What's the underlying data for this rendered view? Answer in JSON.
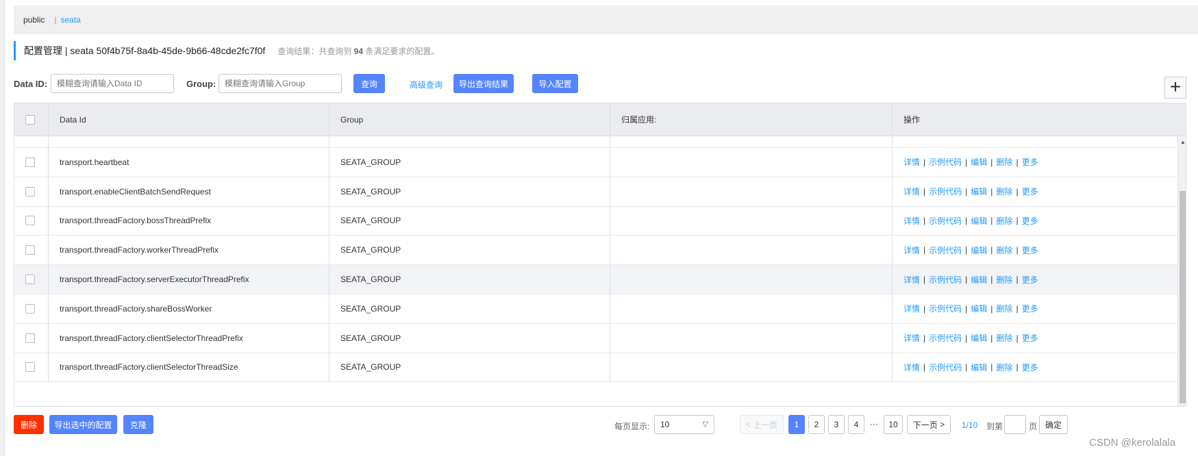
{
  "namespace": {
    "items": [
      "public",
      "seata"
    ],
    "separator": "|"
  },
  "title": {
    "main": "配置管理 | seata 50f4b75f-8a4b-45de-9b66-48cde2fc7f0f",
    "hint_prefix": "查询结果：共查询到",
    "hint_count": "94",
    "hint_suffix": "条满足要求的配置。"
  },
  "search": {
    "data_id_label": "Data ID:",
    "data_id_placeholder": "模糊查询请输入Data ID",
    "group_label": "Group:",
    "group_placeholder": "模糊查询请输入Group",
    "query_button": "查询",
    "advanced_query": "高级查询",
    "export_query": "导出查询结果",
    "import_config": "导入配置",
    "add_icon": "+"
  },
  "table": {
    "headers": [
      "Data Id",
      "Group",
      "归属应用:",
      "操作"
    ],
    "rows": [
      {
        "data_id": "transport.heartbeat",
        "group": "SEATA_GROUP",
        "app": ""
      },
      {
        "data_id": "transport.enableClientBatchSendRequest",
        "group": "SEATA_GROUP",
        "app": ""
      },
      {
        "data_id": "transport.threadFactory.bossThreadPrefix",
        "group": "SEATA_GROUP",
        "app": ""
      },
      {
        "data_id": "transport.threadFactory.workerThreadPrefix",
        "group": "SEATA_GROUP",
        "app": ""
      },
      {
        "data_id": "transport.threadFactory.serverExecutorThreadPrefix",
        "group": "SEATA_GROUP",
        "app": ""
      },
      {
        "data_id": "transport.threadFactory.shareBossWorker",
        "group": "SEATA_GROUP",
        "app": ""
      },
      {
        "data_id": "transport.threadFactory.clientSelectorThreadPrefix",
        "group": "SEATA_GROUP",
        "app": ""
      },
      {
        "data_id": "transport.threadFactory.clientSelectorThreadSize",
        "group": "SEATA_GROUP",
        "app": ""
      }
    ],
    "row_actions": [
      "详情",
      "示例代码",
      "编辑",
      "删除",
      "更多"
    ],
    "highlighted_row": 4
  },
  "footer": {
    "delete_button": "删除",
    "export_selected_button": "导出选中的配置",
    "clone_button": "克隆",
    "page_size_label": "每页显示:",
    "page_size_value": "10",
    "prev_label": "上一页",
    "next_label": "下一页",
    "pages": [
      "1",
      "2",
      "3",
      "4"
    ],
    "ellipsis": "···",
    "last_page": "10",
    "current_page": "1",
    "page_info": "1/10",
    "goto_label": "到第",
    "goto_suffix": "页",
    "confirm_button": "确定"
  },
  "watermark": "CSDN @kerolalala"
}
